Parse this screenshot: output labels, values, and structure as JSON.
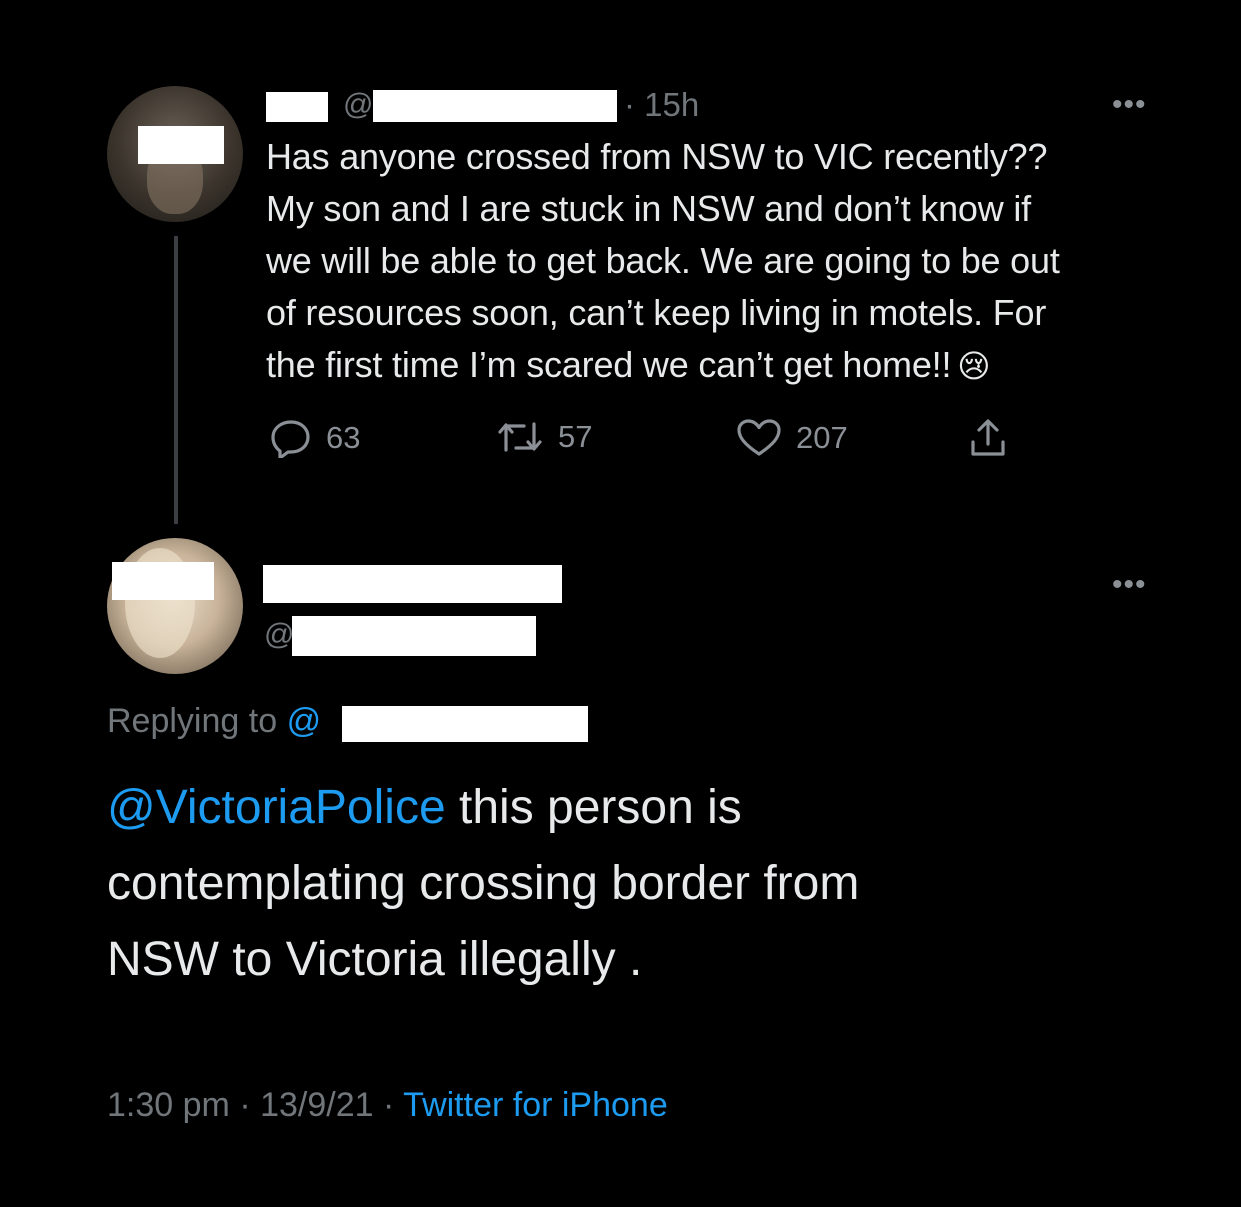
{
  "original_tweet": {
    "handle_prefix": "@",
    "time": "· 15h",
    "more": "•••",
    "lines": [
      "Has anyone crossed from NSW to VIC recently??",
      "My son and I are stuck in NSW and don’t know if",
      "we will be able to get back. We are going to be out",
      "of resources soon, can’t keep living in motels. For",
      "the first time I’m scared we can’t get home!!"
    ],
    "emoji": "😢",
    "actions": {
      "replies": "63",
      "retweets": "57",
      "likes": "207"
    },
    "icons": {
      "reply": "reply-icon",
      "retweet": "retweet-icon",
      "like": "heart-icon",
      "share": "share-icon"
    }
  },
  "reply_tweet": {
    "handle_prefix": "@",
    "more": "•••",
    "replying_to_label": "Replying to",
    "replying_to_at": "@",
    "mention": "@VictoriaPolice",
    "lines": [
      " this person is",
      "contemplating crossing border from",
      "NSW to Victoria illegally ."
    ],
    "time": "1:30 pm",
    "sep1": "·",
    "date": "13/9/21",
    "sep2": "·",
    "source": "Twitter for iPhone"
  },
  "colors": {
    "background": "#000000",
    "text": "#e7e9ea",
    "secondary": "#71767b",
    "link": "#1d9bf0",
    "redaction": "#ffffff"
  }
}
